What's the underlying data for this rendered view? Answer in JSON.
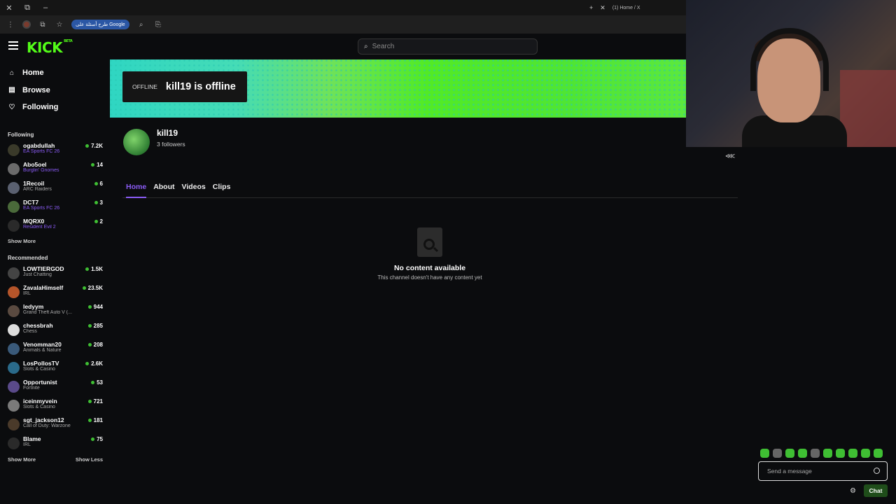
{
  "browser": {
    "window_controls": [
      "✕",
      "⧉",
      "–"
    ],
    "new_tab": "+",
    "tab_close": "✕",
    "tab_title": "(1) Home / X",
    "translate_pill": "طرح أسئلة على Google"
  },
  "header": {
    "logo": "KICK",
    "logo_badge": "BETA",
    "search_placeholder": "Search"
  },
  "sidebar": {
    "nav": [
      {
        "label": "Home",
        "icon": "home-icon"
      },
      {
        "label": "Browse",
        "icon": "browse-icon"
      },
      {
        "label": "Following",
        "icon": "heart-icon"
      }
    ],
    "following_title": "Following",
    "following": [
      {
        "name": "ogabdullah",
        "game": "EA Sports FC 26",
        "viewers": "7.2K",
        "purple": true
      },
      {
        "name": "Abo5oel",
        "game": "Burglin' Gnomes",
        "viewers": "14",
        "purple": true
      },
      {
        "name": "1Recoil",
        "game": "ARC Raiders",
        "viewers": "6",
        "purple": false
      },
      {
        "name": "DCT7",
        "game": "EA Sports FC 26",
        "viewers": "3",
        "purple": true
      },
      {
        "name": "MQRX0",
        "game": "Resident Evil 2",
        "viewers": "2",
        "purple": true
      }
    ],
    "show_more": "Show More",
    "recommended_title": "Recommended",
    "recommended": [
      {
        "name": "LOWTIERGOD",
        "game": "Just Chatting",
        "viewers": "1.5K"
      },
      {
        "name": "ZavalaHimself",
        "game": "IRL",
        "viewers": "23.5K"
      },
      {
        "name": "ledyym",
        "game": "Grand Theft Auto V (...",
        "viewers": "944"
      },
      {
        "name": "chessbrah",
        "game": "Chess",
        "viewers": "285"
      },
      {
        "name": "Venomman20",
        "game": "Animals & Nature",
        "viewers": "208"
      },
      {
        "name": "LosPollosTV",
        "game": "Slots & Casino",
        "viewers": "2.6K"
      },
      {
        "name": "Opportunist",
        "game": "Fortnite",
        "viewers": "53"
      },
      {
        "name": "iceinmyvein",
        "game": "Slots & Casino",
        "viewers": "721"
      },
      {
        "name": "sgt_jackson12",
        "game": "Call of Duty: Warzone",
        "viewers": "181"
      },
      {
        "name": "Blame",
        "game": "IRL",
        "viewers": "75"
      }
    ],
    "show_more_2": "Show More",
    "show_less": "Show Less"
  },
  "banner": {
    "offline_tag": "OFFLINE",
    "offline_text": "kill19 is offline"
  },
  "channel": {
    "name": "kill19",
    "followers": "3 followers"
  },
  "tabs": [
    "Home",
    "About",
    "Videos",
    "Clips"
  ],
  "empty_state": {
    "title": "No content available",
    "subtitle": "This channel doesn't have any content yet"
  },
  "chat": {
    "placeholder": "Send a message",
    "button": "Chat"
  },
  "colors": {
    "brand_green": "#53fc18",
    "accent_purple": "#8b5cf6",
    "live_dot": "#3fbf33"
  }
}
